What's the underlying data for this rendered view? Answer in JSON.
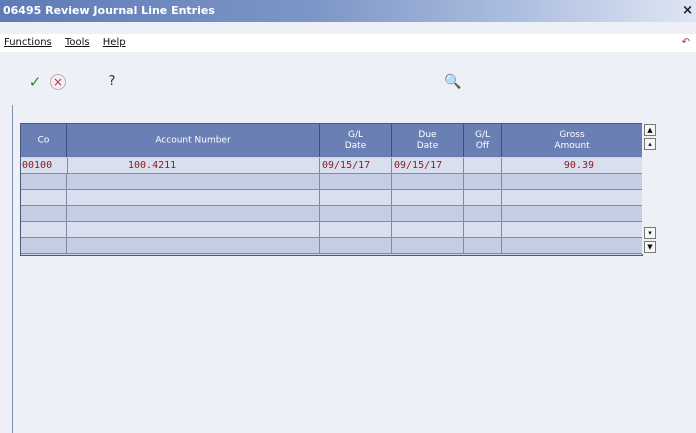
{
  "window": {
    "title": "06495  Review Journal Line Entries",
    "close_label": "×",
    "corner_glyph": "↶"
  },
  "menu": {
    "items": [
      "Functions",
      "Tools",
      "Help"
    ]
  },
  "toolbar": {
    "ok_icon": "✓",
    "cancel_icon": "×",
    "help_icon": "?",
    "search_icon": "🔍"
  },
  "grid": {
    "columns": [
      "Co",
      "Account Number",
      "G/L\nDate",
      "Due\nDate",
      "G/L\nOff",
      "Gross\nAmount"
    ],
    "rows": [
      [
        "00100",
        "100.4211",
        "09/15/17",
        "09/15/17",
        "",
        "90.39"
      ],
      [
        "",
        "",
        "",
        "",
        "",
        ""
      ],
      [
        "",
        "",
        "",
        "",
        "",
        ""
      ],
      [
        "",
        "",
        "",
        "",
        "",
        ""
      ],
      [
        "",
        "",
        "",
        "",
        "",
        ""
      ],
      [
        "",
        "",
        "",
        "",
        "",
        ""
      ]
    ]
  },
  "colors": {
    "header_bg": "#6a7fb4",
    "row_text": "#8a1a1a",
    "title_bg": "#5f7bb6"
  }
}
